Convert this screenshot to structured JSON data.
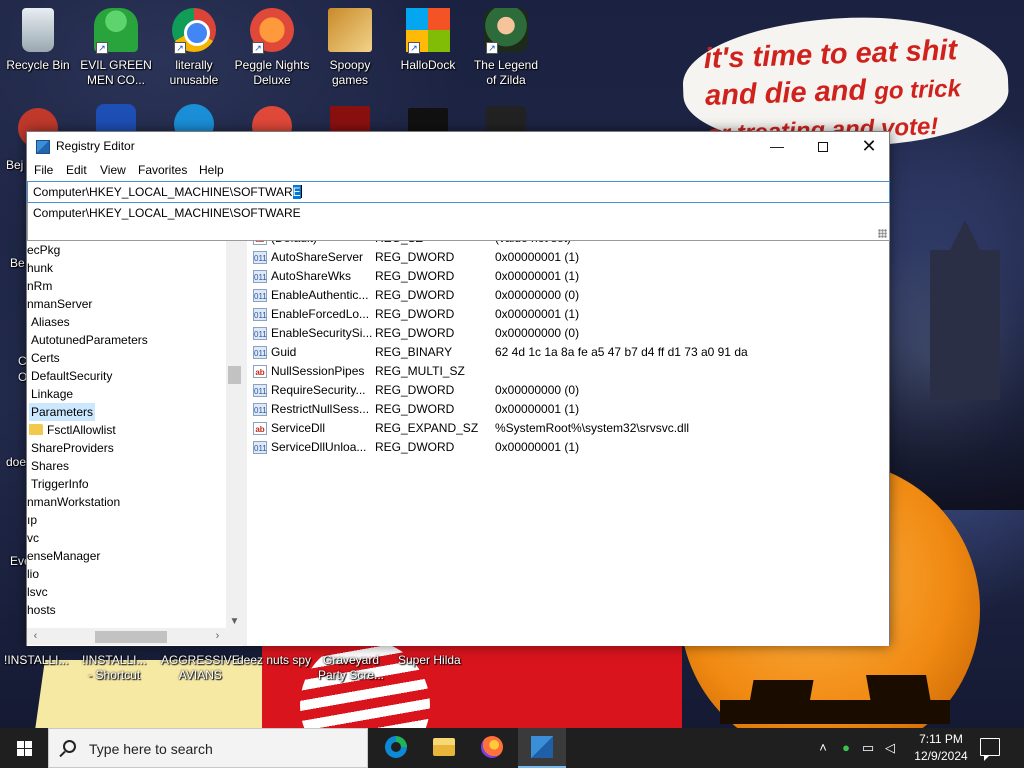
{
  "desktop": {
    "icons_top": [
      {
        "label": "Recycle Bin"
      },
      {
        "label": "EVIL GREEN MEN CO..."
      },
      {
        "label": "literally unusable"
      },
      {
        "label": "Peggle Nights Deluxe"
      },
      {
        "label": "Spoopy games"
      },
      {
        "label": "HalloDock"
      },
      {
        "label": "The Legend of Zilda"
      }
    ],
    "left_partial_labels": [
      "Bej",
      "Be",
      "C",
      "O",
      "doe",
      "Eve"
    ],
    "bottom_labels": [
      "!INSTALLI...",
      "!INSTALLI...",
      "- Shortcut",
      "AGGRESSIVE",
      "AVIANS",
      "deez nuts spy",
      "Graveyard",
      "Party Scre...",
      "Super Hilda"
    ],
    "wallpaper_text": {
      "line1": "it's time to eat shit",
      "line2a": "and die and",
      "line2b": "go trick",
      "line3": "or treating and vote!"
    }
  },
  "window": {
    "title": "Registry Editor",
    "menu": [
      "File",
      "Edit",
      "View",
      "Favorites",
      "Help"
    ],
    "address": {
      "value_prefix": "Computer\\HKEY_LOCAL_MACHINE\\SOFTWAR",
      "value_selected": "E",
      "suggestion": "Computer\\HKEY_LOCAL_MACHINE\\SOFTWARE"
    },
    "tree": [
      "ecPkg",
      "hunk",
      "nRm",
      "nmanServer",
      "Aliases",
      "AutotunedParameters",
      "Certs",
      "DefaultSecurity",
      "Linkage",
      "Parameters",
      "FsctlAllowlist",
      "ShareProviders",
      "Shares",
      "TriggerInfo",
      "nmanWorkstation",
      "ıp",
      "vc",
      "enseManager",
      "lio",
      "lsvc",
      "hosts"
    ],
    "values_partial_row": {
      "name": "(Default)",
      "type": "REG_SZ",
      "data": "(value not set)"
    },
    "values": [
      {
        "icon": "binary",
        "name": "AutoShareServer",
        "type": "REG_DWORD",
        "data": "0x00000001 (1)"
      },
      {
        "icon": "binary",
        "name": "AutoShareWks",
        "type": "REG_DWORD",
        "data": "0x00000001 (1)"
      },
      {
        "icon": "binary",
        "name": "EnableAuthentic...",
        "type": "REG_DWORD",
        "data": "0x00000000 (0)"
      },
      {
        "icon": "binary",
        "name": "EnableForcedLo...",
        "type": "REG_DWORD",
        "data": "0x00000001 (1)"
      },
      {
        "icon": "binary",
        "name": "EnableSecuritySi...",
        "type": "REG_DWORD",
        "data": "0x00000000 (0)"
      },
      {
        "icon": "binary",
        "name": "Guid",
        "type": "REG_BINARY",
        "data": "62 4d 1c 1a 8a fe a5 47 b7 d4 ff d1 73 a0 91 da"
      },
      {
        "icon": "string",
        "name": "NullSessionPipes",
        "type": "REG_MULTI_SZ",
        "data": ""
      },
      {
        "icon": "binary",
        "name": "RequireSecurity...",
        "type": "REG_DWORD",
        "data": "0x00000000 (0)"
      },
      {
        "icon": "binary",
        "name": "RestrictNullSess...",
        "type": "REG_DWORD",
        "data": "0x00000001 (1)"
      },
      {
        "icon": "string",
        "name": "ServiceDll",
        "type": "REG_EXPAND_SZ",
        "data": "%SystemRoot%\\system32\\srvsvc.dll"
      },
      {
        "icon": "binary",
        "name": "ServiceDllUnloa...",
        "type": "REG_DWORD",
        "data": "0x00000001 (1)"
      }
    ]
  },
  "taskbar": {
    "search_placeholder": "Type here to search",
    "apps": [
      "edge-icon",
      "file-explorer-icon",
      "firefox-icon",
      "registry-editor-icon"
    ],
    "time": "7:11 PM",
    "date": "12/9/2024"
  },
  "colors": {
    "accent": "#0078d7",
    "selection_bg": "#cce8ff",
    "taskbar_bg": "#1f1f1f",
    "bubble_text": "#d0221d"
  }
}
